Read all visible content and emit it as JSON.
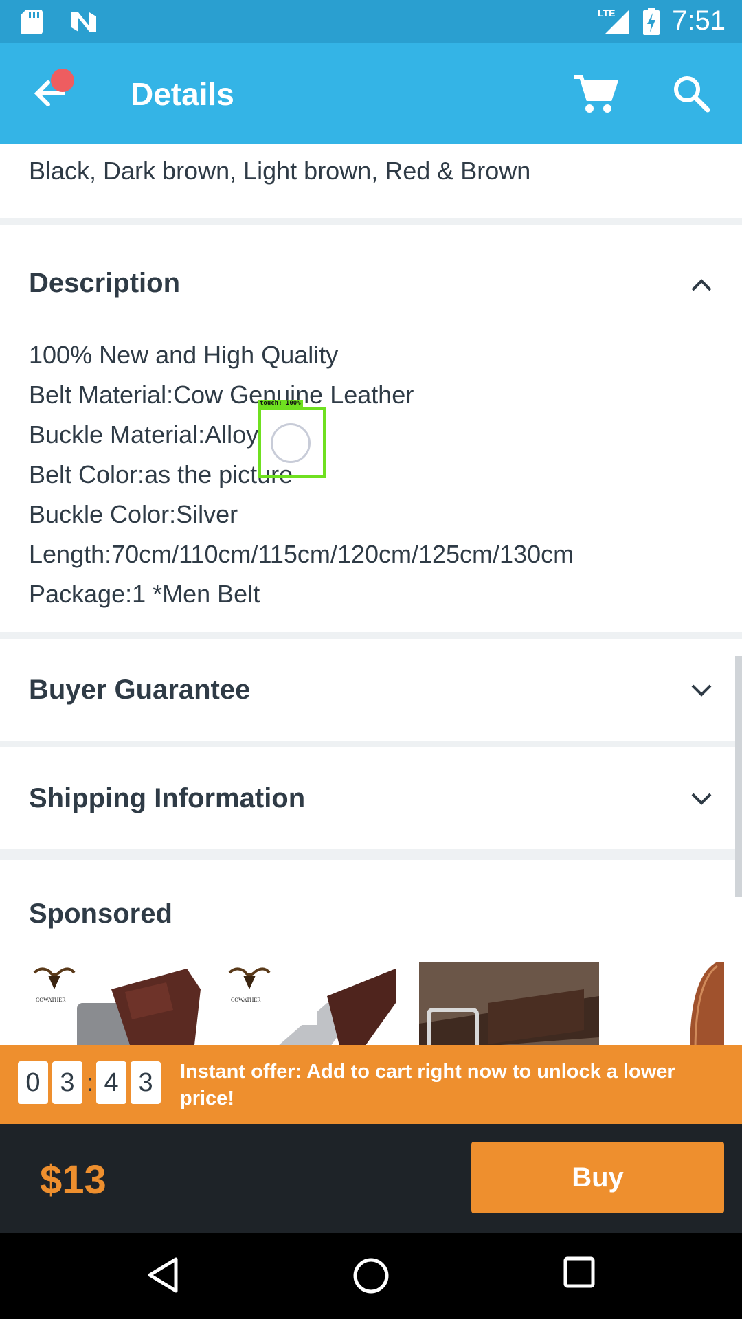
{
  "status_bar": {
    "time": "7:51",
    "network": "LTE",
    "icons": [
      "sd-card-icon",
      "n-notification-icon",
      "signal-icon",
      "battery-charging-icon"
    ]
  },
  "app_bar": {
    "title": "Details",
    "icons": [
      "back-arrow-icon",
      "cart-icon",
      "search-icon"
    ]
  },
  "colors_text": "Black, Dark brown, Light brown, Red & Brown",
  "description": {
    "title": "Description",
    "lines": [
      "100% New and High Quality",
      "Belt Material:Cow Genuine Leather",
      "Buckle Material:Alloy",
      "Belt Color:as the picture",
      "Buckle Color:Silver",
      "Length:70cm/110cm/115cm/120cm/125cm/130cm",
      "Package:1 *Men Belt"
    ]
  },
  "buyer_guarantee": {
    "title": "Buyer Guarantee"
  },
  "shipping": {
    "title": "Shipping Information"
  },
  "sponsored": {
    "title": "Sponsored",
    "brand": "COWATHER"
  },
  "touch_indicator": {
    "label": "touch: 100%"
  },
  "offer": {
    "timer_digits": [
      "0",
      "3",
      "4",
      "3"
    ],
    "separator": ":",
    "text": "Instant offer: Add to cart right now to unlock a lower price!"
  },
  "buy_bar": {
    "price": "$13",
    "buy_label": "Buy"
  },
  "colors": {
    "status_bar": "#2a9fd0",
    "app_bar": "#34b4e6",
    "accent_orange": "#ee8f2e",
    "buy_bar": "#1e2328",
    "notification_dot": "#ee5d60"
  }
}
